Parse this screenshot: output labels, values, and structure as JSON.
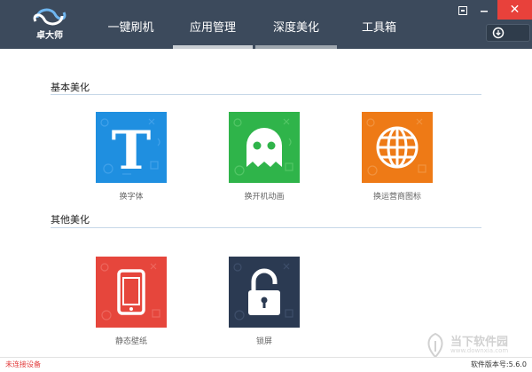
{
  "app": {
    "logo_text": "卓大师",
    "logo_icon": "swirl-logo-icon",
    "brand_color": "#3c4a5c"
  },
  "tabs": [
    {
      "label": "一键刷机",
      "active": false
    },
    {
      "label": "应用管理",
      "active": true
    },
    {
      "label": "深度美化",
      "active": false
    },
    {
      "label": "工具箱",
      "active": false
    }
  ],
  "window": {
    "minimize_icon": "minimize-icon",
    "close_label": "✕",
    "download_icon": "download-icon"
  },
  "sections": [
    {
      "title": "基本美化",
      "items": [
        {
          "label": "换字体",
          "icon": "font-t-icon",
          "color": "#1f8fe0"
        },
        {
          "label": "换开机动画",
          "icon": "ghost-icon",
          "color": "#2fb44a"
        },
        {
          "label": "换运营商图标",
          "icon": "globe-icon",
          "color": "#ee7a16"
        }
      ]
    },
    {
      "title": "其他美化",
      "items": [
        {
          "label": "静态壁纸",
          "icon": "phone-icon",
          "color": "#e6463c"
        },
        {
          "label": "锁屏",
          "icon": "unlock-icon",
          "color": "#2b3a52"
        }
      ]
    }
  ],
  "status": {
    "device_status": "未连接设备",
    "version_text": "软件版本号:5.6.0",
    "device_status_color": "#e23b3b"
  },
  "watermark": {
    "text": "当下软件园",
    "url": "www.downxia.com"
  }
}
